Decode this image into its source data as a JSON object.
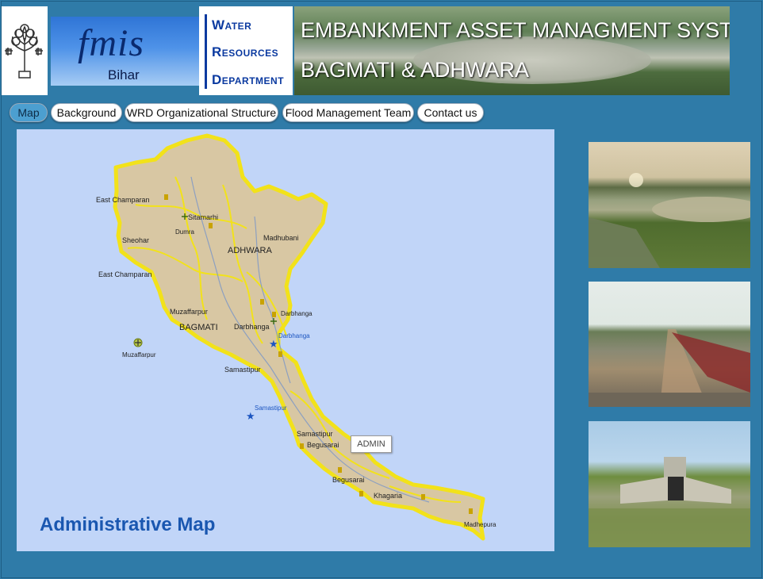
{
  "header": {
    "logo": {
      "name": "fmis",
      "sub": "Bihar"
    },
    "department": {
      "line1": "Water",
      "line2": "Resources",
      "line3": "Department"
    },
    "banner": {
      "title": "EMBANKMENT ASSET MANAGMENT SYSTEM",
      "subtitle": "BAGMATI & ADHWARA"
    }
  },
  "nav": {
    "tabs": [
      {
        "label": "Map",
        "active": true
      },
      {
        "label": "Background"
      },
      {
        "label": "WRD Organizational Structure"
      },
      {
        "label": "Flood Management Team"
      },
      {
        "label": "Contact us"
      }
    ]
  },
  "map": {
    "title": "Administrative Map",
    "tooltip": "ADMIN",
    "labels": {
      "east_champaran_1": "East Champaran",
      "sitamarhi": "Sitamarhi",
      "dumra": "Dumra",
      "sheohar": "Sheohar",
      "madhubani": "Madhubani",
      "adhwara": "ADHWARA",
      "east_champaran_2": "East Champaran",
      "muzaffarpur_1": "Muzaffarpur",
      "bagmati": "BAGMATI",
      "darbhanga_1": "Darbhanga",
      "darbhanga_2": "Darbhanga",
      "darbhanga_3": "Darbhanga",
      "muzaffarpur_2": "Muzaffarpur",
      "samastipur_1": "Samastipur",
      "samastipur_2": "Samastipur",
      "samastipur_3": "Samastipur",
      "begusarai_1": "Begusarai",
      "begusarai_2": "Begusarai",
      "khagaria": "Khagaria",
      "madhepura": "Madhepura"
    }
  },
  "colors": {
    "page_bg": "#2f7ba8",
    "map_bg": "#c1d5f8",
    "region_fill": "#d8c7a3",
    "boundary": "#f2e21a",
    "title": "#1a57b0"
  },
  "icons": {
    "emblem": "bihar-emblem-icon",
    "airport": "airport-icon",
    "star": "star-icon",
    "marker": "bus-marker-icon"
  }
}
